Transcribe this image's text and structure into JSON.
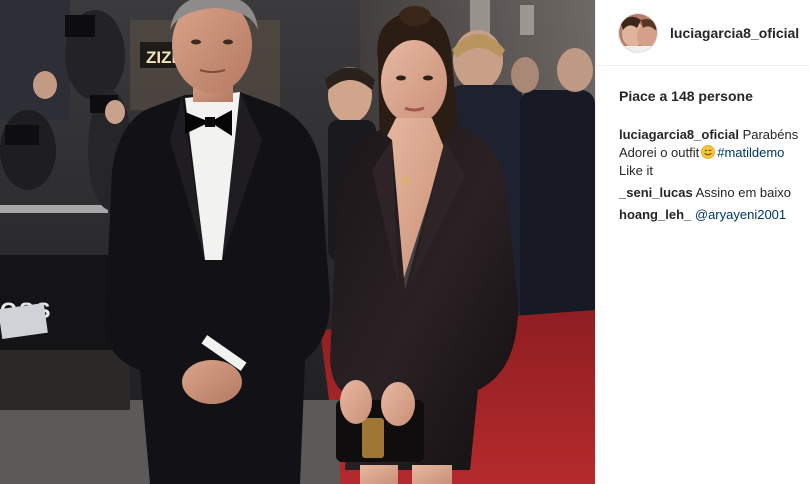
{
  "post": {
    "username": "luciagarcia8_oficial",
    "likes_text": "Piace a 148 persone",
    "caption": {
      "user": "luciagarcia8_oficial",
      "line1_text": "Parabéns",
      "line2_text": "Adorei o outfit",
      "line2_emoji": "winking-face-icon",
      "line2_hashtag": "#matildemo",
      "line3_text": "Like it"
    },
    "comments": [
      {
        "user": "_seni_lucas",
        "text": "Assino em baixo"
      },
      {
        "user": "hoang_leh_",
        "mention": "@aryayeni2001"
      }
    ]
  },
  "photo": {
    "background_signs": [
      "ZIZI",
      "OSS"
    ]
  },
  "colors": {
    "link": "#003569",
    "text": "#262626",
    "divider": "#efefef"
  }
}
